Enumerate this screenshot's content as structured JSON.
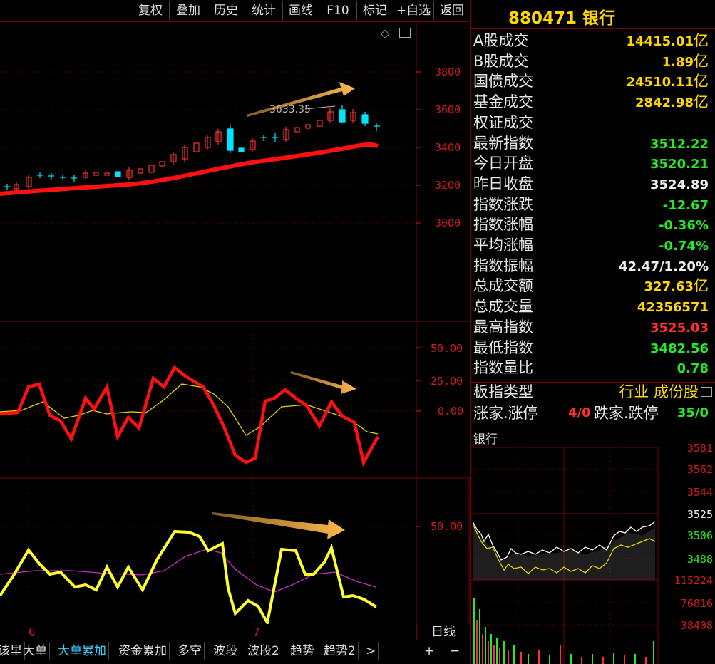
{
  "toolbar": {
    "buttons": [
      "复权",
      "叠加",
      "历史",
      "统计",
      "画线",
      "F10",
      "标记",
      "+自选",
      "返回"
    ]
  },
  "main_chart": {
    "price_axis": [
      "3800",
      "3600",
      "3400",
      "3200",
      "3000"
    ],
    "peak_label": "3633.35",
    "indicator1_axis": [
      "50.00",
      "25.00",
      "0.00"
    ],
    "indicator2_axis": [
      "50.00"
    ],
    "date_marks": [
      "6",
      "7"
    ],
    "period": "日线"
  },
  "bottom_tabs": [
    "该里",
    "大单",
    "大单累加",
    "资金累加",
    "多空",
    "波段",
    "波段2",
    "趋势",
    "趋势2",
    ">"
  ],
  "bottom_controls": [
    "+",
    "−"
  ],
  "quote": {
    "code_name": "880471 银行",
    "rows": [
      {
        "label": "A股成交",
        "value": "14415.01",
        "unit": "亿",
        "color": "#ffd700"
      },
      {
        "label": "B股成交",
        "value": "1.89",
        "unit": "亿",
        "color": "#ffd700"
      },
      {
        "label": "国债成交",
        "value": "24510.11",
        "unit": "亿",
        "color": "#ffd700"
      },
      {
        "label": "基金成交",
        "value": "2842.98",
        "unit": "亿",
        "color": "#ffd700"
      },
      {
        "label": "权证成交",
        "value": "",
        "unit": "",
        "color": "#ffd700"
      },
      {
        "label": "最新指数",
        "value": "3512.22",
        "unit": "",
        "color": "#28e628"
      },
      {
        "label": "今日开盘",
        "value": "3520.21",
        "unit": "",
        "color": "#28e628"
      },
      {
        "label": "昨日收盘",
        "value": "3524.89",
        "unit": "",
        "color": "#f0f0f0"
      },
      {
        "label": "指数涨跌",
        "value": "-12.67",
        "unit": "",
        "color": "#28e628"
      },
      {
        "label": "指数涨幅",
        "value": "-0.36%",
        "unit": "",
        "color": "#28e628"
      },
      {
        "label": "平均涨幅",
        "value": "-0.74%",
        "unit": "",
        "color": "#28e628"
      },
      {
        "label": "指数振幅",
        "value": "42.47/1.20%",
        "unit": "",
        "color": "#f0f0f0"
      },
      {
        "label": "总成交额",
        "value": "327.63",
        "unit": "亿",
        "color": "#ffd700"
      },
      {
        "label": "总成交量",
        "value": "42356571",
        "unit": "",
        "color": "#ffd700"
      },
      {
        "label": "最高指数",
        "value": "3525.03",
        "unit": "",
        "color": "#ff3030"
      },
      {
        "label": "最低指数",
        "value": "3482.56",
        "unit": "",
        "color": "#28e628"
      },
      {
        "label": "指数量比",
        "value": "0.78",
        "unit": "",
        "color": "#28e628"
      }
    ],
    "type_label": "板指类型",
    "type_value": "行业 成份股",
    "up_label": "涨家.涨停",
    "up_value": "4/0",
    "down_label": "跌家.跌停",
    "down_value": "35/0"
  },
  "intraday": {
    "title": "银行",
    "price_axis": [
      "3581",
      "3562",
      "3544",
      "3525",
      "3506",
      "3488"
    ],
    "volume_axis": [
      "115224",
      "76816",
      "38408"
    ]
  }
}
